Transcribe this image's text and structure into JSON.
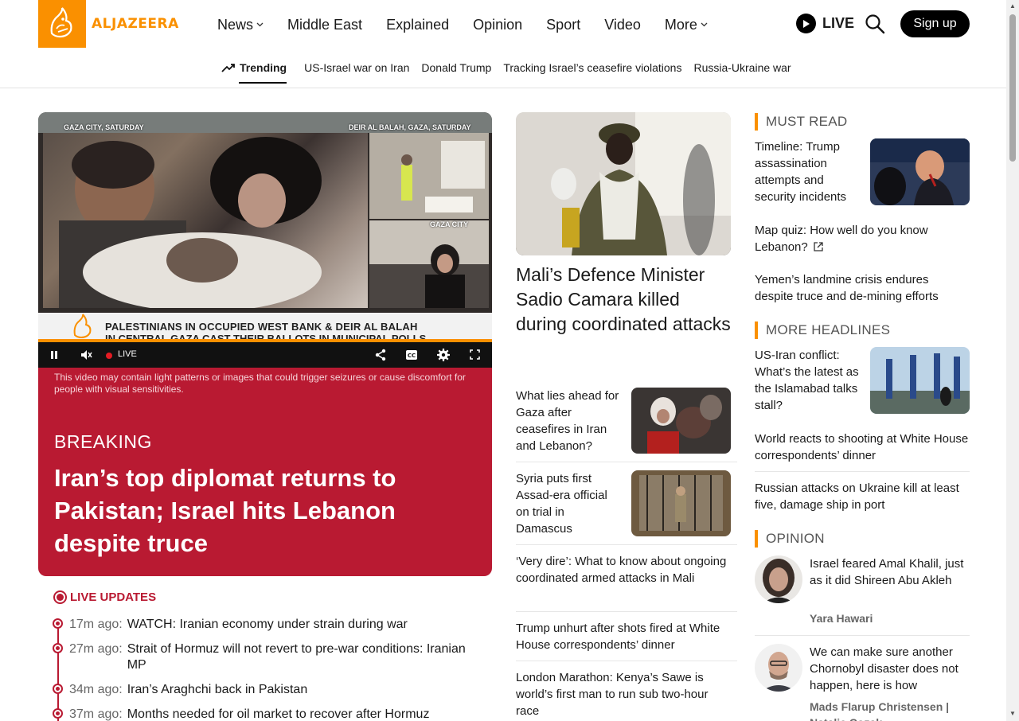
{
  "brand": {
    "name": "ALJAZEERA",
    "accent": "#fa9000",
    "breaking_bg": "#b91a32"
  },
  "nav": {
    "items": [
      {
        "label": "News",
        "has_dropdown": true
      },
      {
        "label": "Middle East",
        "has_dropdown": false
      },
      {
        "label": "Explained",
        "has_dropdown": false
      },
      {
        "label": "Opinion",
        "has_dropdown": false
      },
      {
        "label": "Sport",
        "has_dropdown": false
      },
      {
        "label": "Video",
        "has_dropdown": false
      },
      {
        "label": "More",
        "has_dropdown": true
      }
    ],
    "live_label": "LIVE",
    "signup_label": "Sign up",
    "search_icon": "search-icon"
  },
  "trending": {
    "label": "Trending",
    "links": [
      "US-Israel war on Iran",
      "Donald Trump",
      "Tracking Israel’s ceasefire violations",
      "Russia-Ukraine war"
    ]
  },
  "video": {
    "caption_left": "GAZA CITY, SATURDAY",
    "caption_right": "DEIR AL BALAH, GAZA, SATURDAY",
    "caption_small": "GAZA CITY",
    "lower_third_1": "PALESTINIANS IN OCCUPIED WEST BANK & DEIR AL BALAH",
    "lower_third_2": "IN CENTRAL GAZA CAST THEIR BALLOTS IN MUNICIPAL POLLS",
    "live_label": "LIVE",
    "warning": "This video may contain light patterns or images that could trigger seizures or cause discomfort for people with visual sensitivities."
  },
  "breaking": {
    "label": "BREAKING",
    "title": "Iran’s top diplomat returns to Pakistan; Israel hits Lebanon despite truce"
  },
  "live_updates": {
    "title": "LIVE UPDATES",
    "items": [
      {
        "time": "17m ago:",
        "text": "WATCH: Iranian economy under strain during war"
      },
      {
        "time": "27m ago:",
        "text": "Strait of Hormuz will not revert to pre-war conditions: Iranian MP"
      },
      {
        "time": "34m ago:",
        "text": "Iran’s Araghchi back in Pakistan"
      },
      {
        "time": "37m ago:",
        "text": "Months needed for oil market to recover after Hormuz"
      }
    ]
  },
  "middle": {
    "lead_title": "Mali’s Defence Minister Sadio Camara killed during coordinated attacks",
    "stories": [
      {
        "title": "What lies ahead for Gaza after ceasefires in Iran and Lebanon?"
      },
      {
        "title": "Syria puts first Assad-era official on trial in Damascus"
      },
      {
        "title": "‘Very dire’: What to know about ongoing coordinated armed attacks in Mali"
      },
      {
        "title": "Trump unhurt after shots fired at White House correspondents’ dinner"
      },
      {
        "title": "London Marathon: Kenya’s Sawe is world’s first man to run sub two-hour race"
      }
    ]
  },
  "right": {
    "must_read": {
      "title": "MUST READ",
      "stories": [
        {
          "title": "Timeline: Trump assassination attempts and security incidents"
        },
        {
          "title": "Map quiz: How well do you know Lebanon?"
        },
        {
          "title": "Yemen’s landmine crisis endures despite truce and de-mining efforts"
        }
      ]
    },
    "more_headlines": {
      "title": "MORE HEADLINES",
      "stories": [
        {
          "title": "US-Iran conflict: What’s the latest as the Islamabad talks stall?"
        },
        {
          "title": "World reacts to shooting at White House correspondents’ dinner"
        },
        {
          "title": "Russian attacks on Ukraine kill at least five, damage ship in port"
        }
      ]
    },
    "opinion": {
      "title": "OPINION",
      "items": [
        {
          "title": "Israel feared Amal Khalil, just as it did Shireen Abu Akleh",
          "author": "Yara Hawari"
        },
        {
          "title": "We can make sure another Chornobyl disaster does not happen, here is how",
          "author": "Mads Flarup Christensen | Natalie Cozak"
        }
      ]
    }
  }
}
